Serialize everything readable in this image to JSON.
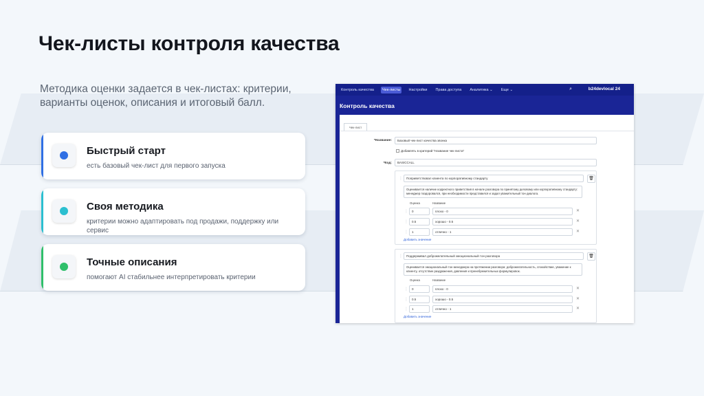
{
  "slide": {
    "title": "Чек-листы контроля качества",
    "lead": "Методика оценки задается в чек-листах: критерии, варианты оценок, описания и итоговый балл."
  },
  "cards": [
    {
      "title": "Быстрый старт",
      "desc": "есть базовый чек-лист для первого запуска",
      "color": "#2f6fe4"
    },
    {
      "title": "Своя методика",
      "desc": "критерии можно адаптировать под продажи, поддержку или сервис",
      "color": "#2bbfd0"
    },
    {
      "title": "Точные описания",
      "desc": "помогают AI стабильнее интерпретировать критерии",
      "color": "#2fbf6a"
    }
  ],
  "colors": {
    "nav_bg": "#14208a",
    "header_bg": "#1a2596",
    "accent_blue": "#2f6fe4",
    "accent_cyan": "#2bbfd0",
    "accent_green": "#2fbf6a"
  },
  "app": {
    "nav": [
      "Контроль качества",
      "Чек-листы",
      "Настройки",
      "Права доступа",
      "Аналитика ⌄",
      "Еще ⌄"
    ],
    "search_icon": "search-icon",
    "brand": "b24devlocal 24",
    "page_title": "Контроль качества",
    "tab": "Чек-лист",
    "form": {
      "name_label": "*Название:",
      "name_value": "Базовый чек-лист качества звонка",
      "checkbox_label": "Добавлять в критерий \"Название чек-листа\"",
      "code_label": "*Код:",
      "code_value": "BASICCALL"
    },
    "criteria": [
      {
        "name": "Поприветствовал клиента по корпоративному стандарту",
        "desc": "Оценивается наличие корректного приветствия в начале разговора по принятому деловому или корпоративному стандарту: менеджер поздоровался, при необходимости представился и задал уважительный тон диалога.",
        "col_score": "Оценка",
        "col_name": "Название",
        "rows": [
          {
            "score": "0",
            "name": "плохо - 0"
          },
          {
            "score": "0.5",
            "name": "хорошо - 0.5"
          },
          {
            "score": "1",
            "name": "отлично - 1"
          }
        ],
        "add_label": "Добавить значение"
      },
      {
        "name": "Поддерживал доброжелательный эмоциональный тон разговора",
        "desc": "Оценивается эмоциональный тон менеджера на протяжении разговора: доброжелательность, спокойствие, уважение к клиенту, отсутствие раздражения, давления и пренебрежительных формулировок.",
        "col_score": "Оценка",
        "col_name": "Название",
        "rows": [
          {
            "score": "0",
            "name": "плохо - 0"
          },
          {
            "score": "0.5",
            "name": "хорошо - 0.5"
          },
          {
            "score": "1",
            "name": "отлично - 1"
          }
        ],
        "add_label": "Добавить значение"
      }
    ]
  }
}
